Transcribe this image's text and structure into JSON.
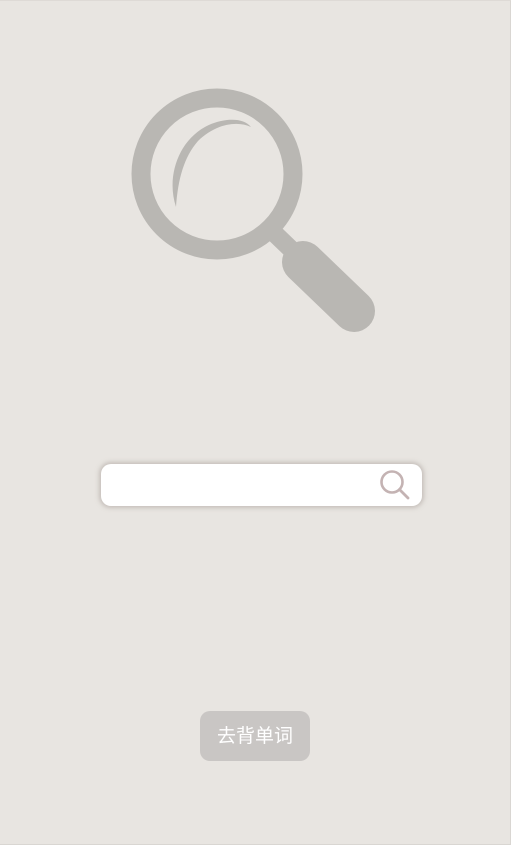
{
  "hero": {
    "icon": "magnifier-icon",
    "color": "#b9b7b3"
  },
  "search": {
    "value": "",
    "placeholder": "",
    "button_icon": "search-icon",
    "icon_color": "#c4b3b3"
  },
  "action_button": {
    "label": "去背单词",
    "background": "#c9c6c4",
    "text_color": "#ffffff"
  },
  "theme": {
    "background": "#e8e5e1"
  }
}
